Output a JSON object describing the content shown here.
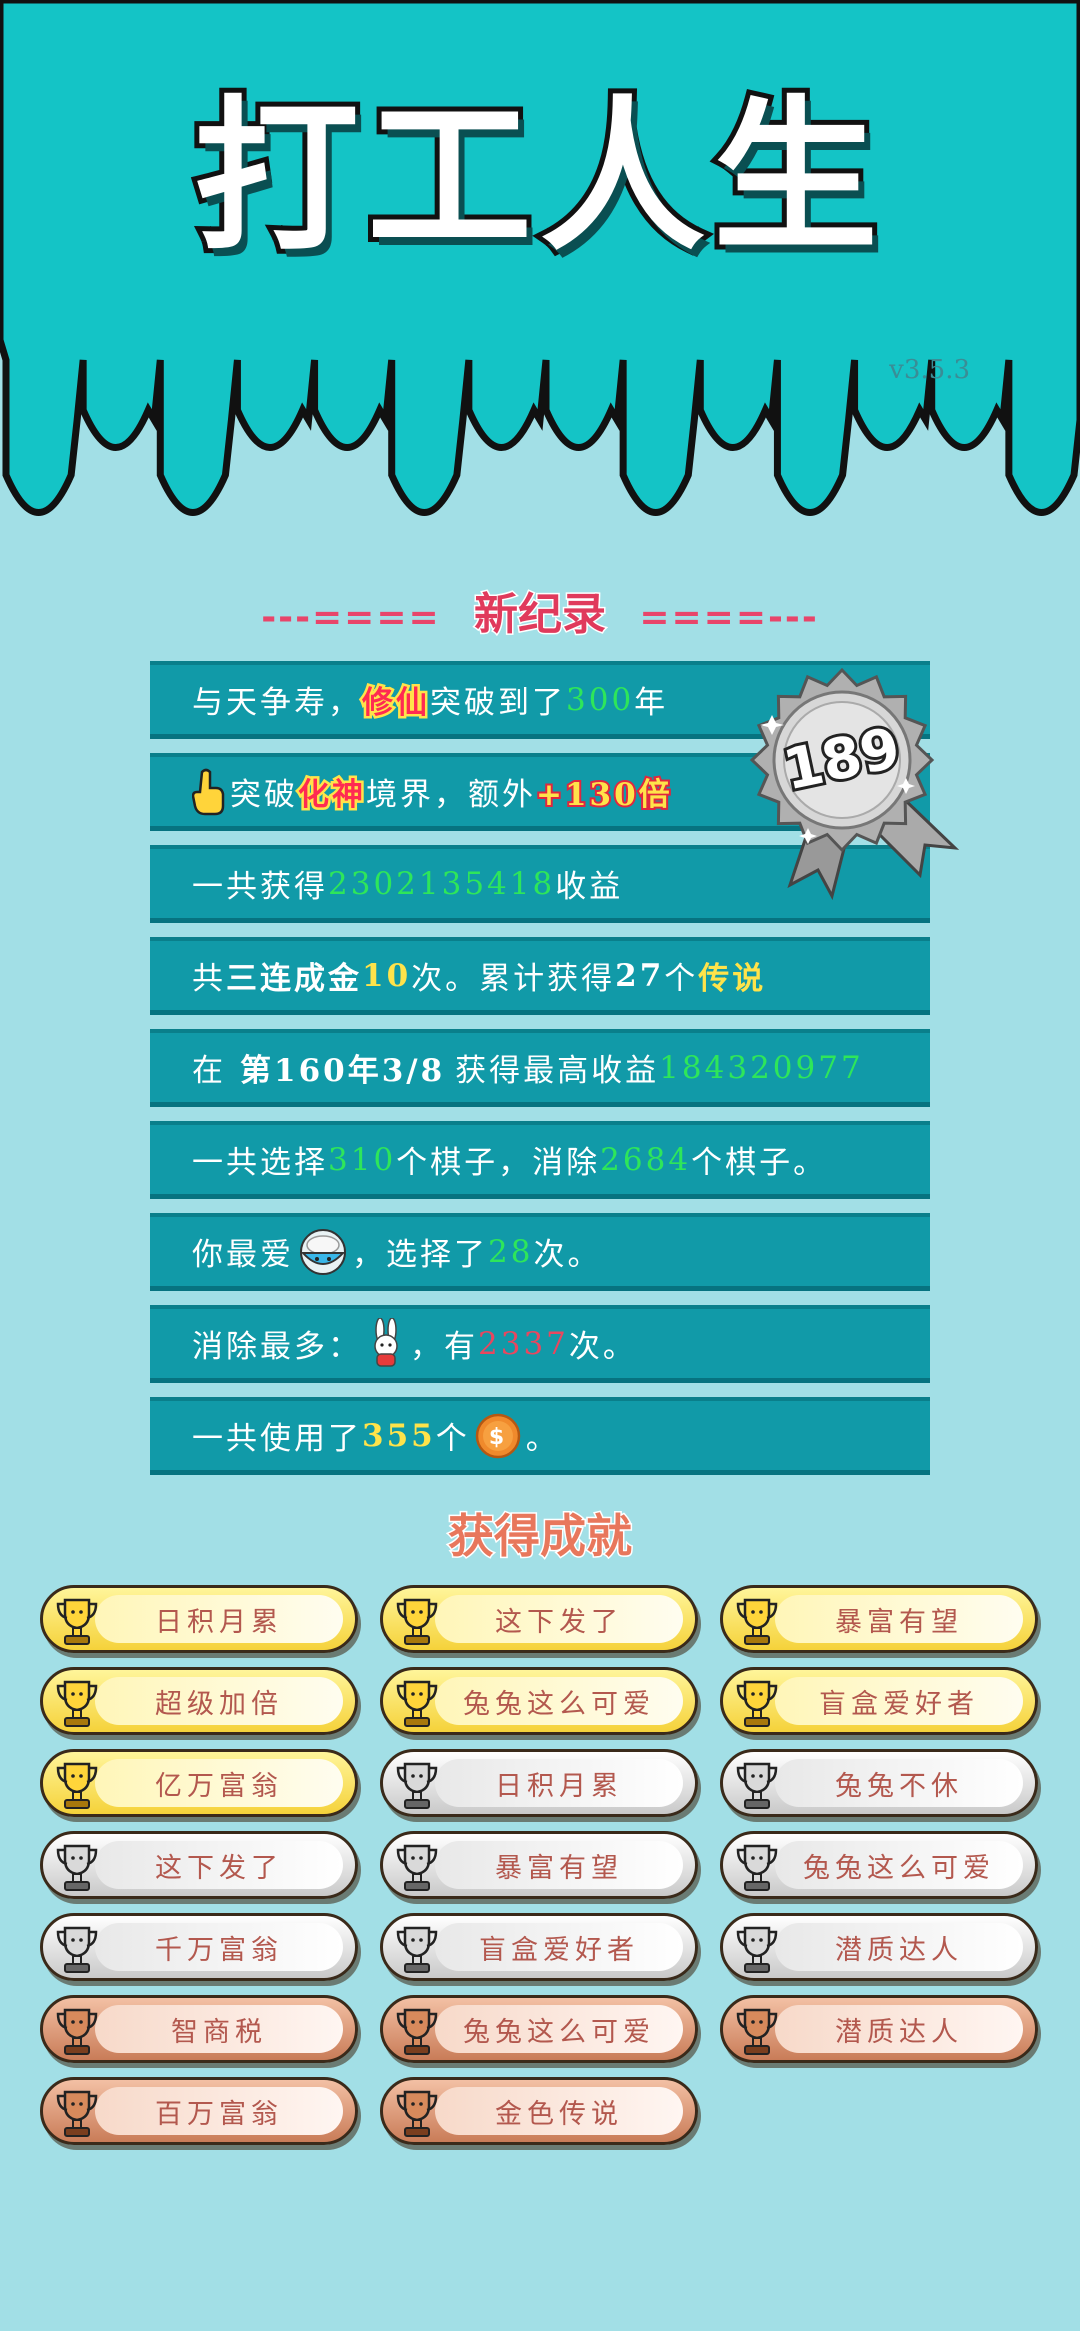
{
  "app": {
    "title": "打工人生",
    "version": "v3.5.3"
  },
  "record": {
    "heading_left": "---====",
    "heading": "新纪录",
    "heading_right": "====---",
    "badge_number": "189",
    "rows": {
      "r1": {
        "a": "与天争寿，",
        "b": "修仙",
        "c": "突破到了",
        "d": "300",
        "e": "年"
      },
      "r2": {
        "a": "突破",
        "b": "化神",
        "c": "境界，额外",
        "d": "+130倍"
      },
      "r3": {
        "a": "一共获得",
        "b": "2302135418",
        "c": "收益"
      },
      "r4": {
        "a": "共",
        "b": "三连成金",
        "c": "10",
        "d": "次。累计获得",
        "e": "27",
        "f": "个",
        "g": "传说"
      },
      "r5": {
        "a": "在",
        "b": "第160年3/8",
        "c": "获得最高收益",
        "d": "184320977"
      },
      "r6": {
        "a": "一共选择",
        "b": "310",
        "c": "个棋子，消除",
        "d": "2684",
        "e": "个棋子。"
      },
      "r7": {
        "a": "你最爱",
        "b": "，选择了",
        "c": "28",
        "d": "次。"
      },
      "r8": {
        "a": "消除最多：",
        "b": "，有",
        "c": "2337",
        "d": "次。"
      },
      "r9": {
        "a": "一共使用了",
        "b": "355",
        "c": "个",
        "d": "。"
      }
    }
  },
  "achievements": {
    "heading": "获得成就",
    "items": [
      {
        "label": "日积月累",
        "tier": "gold"
      },
      {
        "label": "这下发了",
        "tier": "gold"
      },
      {
        "label": "暴富有望",
        "tier": "gold"
      },
      {
        "label": "超级加倍",
        "tier": "gold"
      },
      {
        "label": "兔兔这么可爱",
        "tier": "gold"
      },
      {
        "label": "盲盒爱好者",
        "tier": "gold"
      },
      {
        "label": "亿万富翁",
        "tier": "gold"
      },
      {
        "label": "日积月累",
        "tier": "silver"
      },
      {
        "label": "兔兔不休",
        "tier": "silver"
      },
      {
        "label": "这下发了",
        "tier": "silver"
      },
      {
        "label": "暴富有望",
        "tier": "silver"
      },
      {
        "label": "兔兔这么可爱",
        "tier": "silver"
      },
      {
        "label": "千万富翁",
        "tier": "silver"
      },
      {
        "label": "盲盒爱好者",
        "tier": "silver"
      },
      {
        "label": "潜质达人",
        "tier": "silver"
      },
      {
        "label": "智商税",
        "tier": "bronze"
      },
      {
        "label": "兔兔这么可爱",
        "tier": "bronze"
      },
      {
        "label": "潜质达人",
        "tier": "bronze"
      },
      {
        "label": "百万富翁",
        "tier": "bronze"
      },
      {
        "label": "金色传说",
        "tier": "bronze"
      }
    ]
  },
  "colors": {
    "header": "#14c4c6",
    "background": "#a2dfe6",
    "row": "#119aa8",
    "number_green": "#2ee65a",
    "number_yellow": "#ffe34a",
    "number_red": "#e8475f"
  },
  "icons": [
    "pointing-hand-icon",
    "rice-bowl-icon",
    "rabbit-icon",
    "coin-icon",
    "trophy-icon",
    "badge-icon"
  ]
}
